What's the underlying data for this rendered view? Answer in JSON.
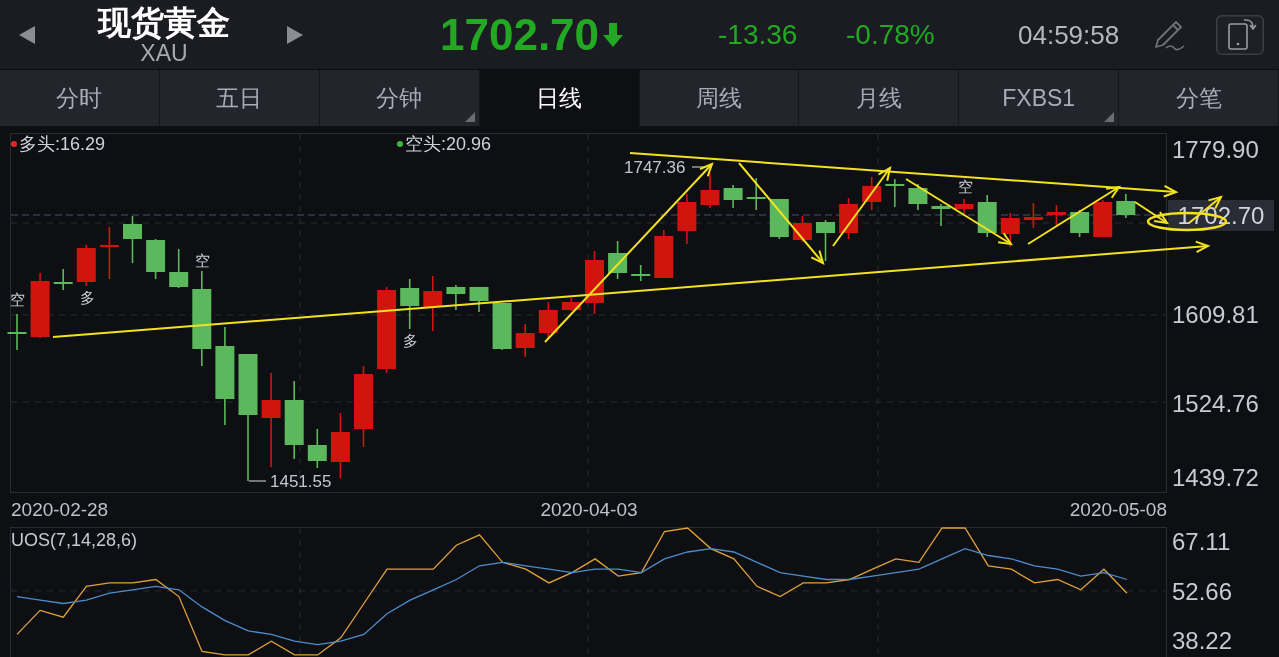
{
  "header": {
    "title": "现货黄金",
    "symbol": "XAU",
    "price": "1702.70",
    "falling": true,
    "change": "-13.36",
    "change_percent": "-0.78%",
    "time": "04:59:58"
  },
  "tabs": [
    {
      "label": "分时",
      "selected": false,
      "has_menu": false
    },
    {
      "label": "五日",
      "selected": false,
      "has_menu": false
    },
    {
      "label": "分钟",
      "selected": false,
      "has_menu": true
    },
    {
      "label": "日线",
      "selected": true,
      "has_menu": false
    },
    {
      "label": "周线",
      "selected": false,
      "has_menu": false
    },
    {
      "label": "月线",
      "selected": false,
      "has_menu": false
    },
    {
      "label": "FXBS1",
      "selected": false,
      "has_menu": true
    },
    {
      "label": "分笔",
      "selected": false,
      "has_menu": false
    }
  ],
  "price_chart": {
    "legend": [
      {
        "text": "多头:16.29",
        "color": "#e0282a"
      },
      {
        "text": "空头:20.96",
        "color": "#3cba3c"
      }
    ],
    "signal_marks": [
      "空",
      "多",
      "空",
      "多",
      "空"
    ],
    "high_label": "1747.36",
    "low_label": "1451.55",
    "price_axis": [
      "1779.90",
      "1609.81",
      "1524.76",
      "1439.72"
    ],
    "current_price": "1702.70",
    "dates": [
      "2020-02-28",
      "2020-04-03",
      "2020-05-08"
    ]
  },
  "indicator": {
    "chart_data": {
      "type": "line",
      "title": "UOS(7,14,28,6)",
      "ylim": [
        33.4,
        71.3
      ],
      "yticks": [
        67.11,
        52.66,
        38.22
      ],
      "series": [
        {
          "color": "#dfa23a",
          "values": [
            40,
            47,
            45,
            54,
            55,
            55,
            56,
            51,
            35,
            34,
            34,
            38,
            34,
            34,
            39,
            49,
            59,
            59,
            59,
            66,
            69,
            61,
            59,
            55,
            58,
            62,
            57,
            58,
            70,
            71,
            65,
            62,
            54,
            51,
            55,
            55,
            56,
            59,
            62,
            61,
            71,
            71,
            60,
            59,
            55,
            56,
            53,
            59,
            52
          ]
        },
        {
          "color": "#4d8ccc",
          "values": [
            51,
            50,
            49,
            50,
            52,
            53,
            54,
            53,
            48,
            44,
            41,
            40,
            38,
            37,
            38,
            40,
            46,
            50,
            53,
            56,
            60,
            61,
            60,
            59,
            58,
            59,
            59,
            58,
            62,
            64,
            65,
            64,
            61,
            58,
            57,
            56,
            56,
            57,
            58,
            59,
            62,
            65,
            63,
            62,
            60,
            59,
            57,
            58,
            56
          ]
        }
      ]
    }
  }
}
